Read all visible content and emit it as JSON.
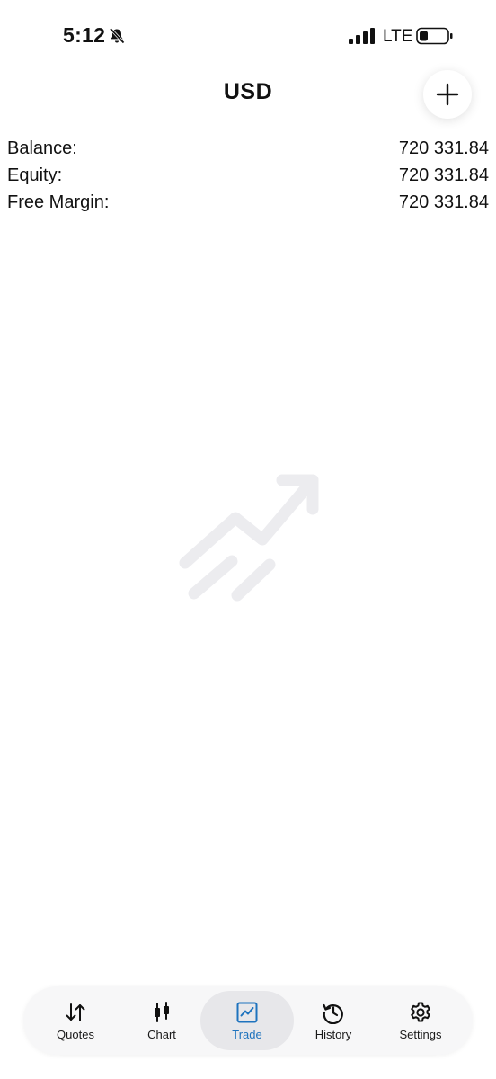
{
  "status_bar": {
    "time": "5:12",
    "network": "LTE",
    "icons": [
      "bell-slash-icon",
      "signal-icon",
      "battery-icon"
    ]
  },
  "header": {
    "title": "USD",
    "add_icon": "plus-icon"
  },
  "account": [
    {
      "label": "Balance:",
      "value": "720 331.84"
    },
    {
      "label": "Equity:",
      "value": "720 331.84"
    },
    {
      "label": "Free Margin:",
      "value": "720 331.84"
    }
  ],
  "empty_state": {
    "icon": "trend-up-icon",
    "color": "#ececef"
  },
  "tabbar": {
    "active": "Trade",
    "accent": "#1e73be",
    "tabs": [
      {
        "label": "Quotes",
        "icon": "arrows-up-down-icon"
      },
      {
        "label": "Chart",
        "icon": "candlestick-icon"
      },
      {
        "label": "Trade",
        "icon": "trade-chart-icon"
      },
      {
        "label": "History",
        "icon": "history-clock-icon"
      },
      {
        "label": "Settings",
        "icon": "gear-icon"
      }
    ]
  }
}
